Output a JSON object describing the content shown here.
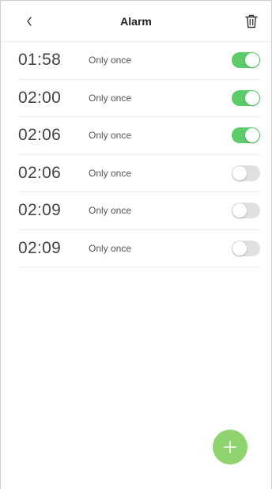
{
  "header": {
    "title": "Alarm",
    "back_icon": "chevron-left-icon",
    "delete_icon": "trash-icon"
  },
  "alarms": [
    {
      "time": "01:58",
      "repeat": "Only once",
      "enabled": true
    },
    {
      "time": "02:00",
      "repeat": "Only once",
      "enabled": true
    },
    {
      "time": "02:06",
      "repeat": "Only once",
      "enabled": true
    },
    {
      "time": "02:06",
      "repeat": "Only once",
      "enabled": false
    },
    {
      "time": "02:09",
      "repeat": "Only once",
      "enabled": false
    },
    {
      "time": "02:09",
      "repeat": "Only once",
      "enabled": false
    }
  ],
  "fab": {
    "icon": "plus-icon"
  },
  "colors": {
    "toggle_on": "#5ccc6a",
    "toggle_off": "#e0e0e0",
    "fab": "#8fd36e"
  }
}
